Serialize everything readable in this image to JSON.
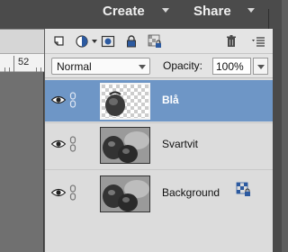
{
  "header": {
    "create_label": "Create",
    "share_label": "Share"
  },
  "document": {
    "ruler_number": "52"
  },
  "layers_toolbar": {
    "icons": [
      "new-layer-icon",
      "adjustment-layer-icon",
      "layer-mask-icon",
      "lock-icon",
      "lock-transparency-icon",
      "trash-icon",
      "panel-menu-icon"
    ]
  },
  "layer_options": {
    "blend_mode": "Normal",
    "opacity_label": "Opacity:",
    "opacity_value": "100%"
  },
  "layers": [
    {
      "name": "Blå",
      "visible": true,
      "selected": true,
      "thumbnail": "transparent-strawberry"
    },
    {
      "name": "Svartvit",
      "visible": true,
      "selected": false,
      "thumbnail": "strawberries-bw"
    },
    {
      "name": "Background",
      "visible": true,
      "selected": false,
      "thumbnail": "strawberries-bw",
      "locked": true
    }
  ],
  "colors": {
    "selected_row": "#6e96c6",
    "panel_bg": "#dcdcdc",
    "topbar_bg": "#4b4b4b"
  }
}
